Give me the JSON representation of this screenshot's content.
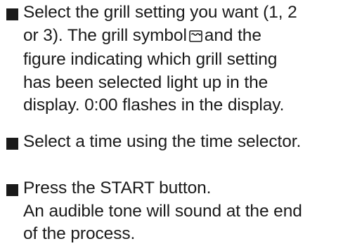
{
  "steps": [
    {
      "text_before_icon": "Select the grill setting you want (1, 2\nor 3). The grill symbol",
      "icon": "grill-symbol-icon",
      "text_after_icon": "and the\nfigure indicating which grill setting\nhas been selected light up in the\ndisplay. 0:00 flashes in the display."
    },
    {
      "text": "Select a time using the time selector."
    },
    {
      "text": "Press the START button.\nAn audible tone will sound at the end\nof the process."
    }
  ]
}
